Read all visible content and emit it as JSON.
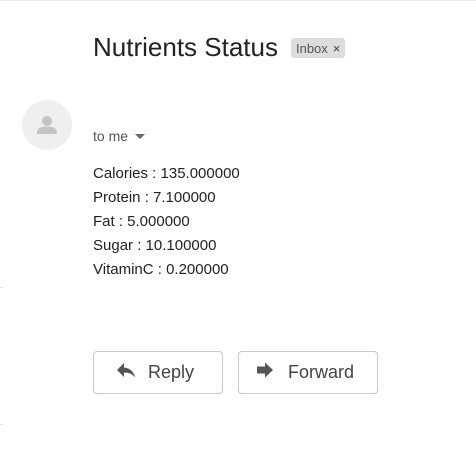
{
  "email": {
    "subject": "Nutrients Status",
    "label": "Inbox",
    "label_close_glyph": "×",
    "recipient": "to me",
    "body_lines": [
      "Calories : 135.000000",
      "Protein : 7.100000",
      "Fat : 5.000000",
      "Sugar : 10.100000",
      "VitaminC : 0.200000"
    ]
  },
  "actions": {
    "reply_label": "Reply",
    "forward_label": "Forward"
  },
  "icons": {
    "avatar": "person-icon",
    "reply": "reply-arrow-icon",
    "forward": "forward-arrow-icon",
    "recipient_dropdown": "caret-down-icon"
  },
  "colors": {
    "chip_background": "#dddddd",
    "avatar_background": "#efefef",
    "button_border": "#c8c8c8",
    "icon_gray": "#555555"
  }
}
